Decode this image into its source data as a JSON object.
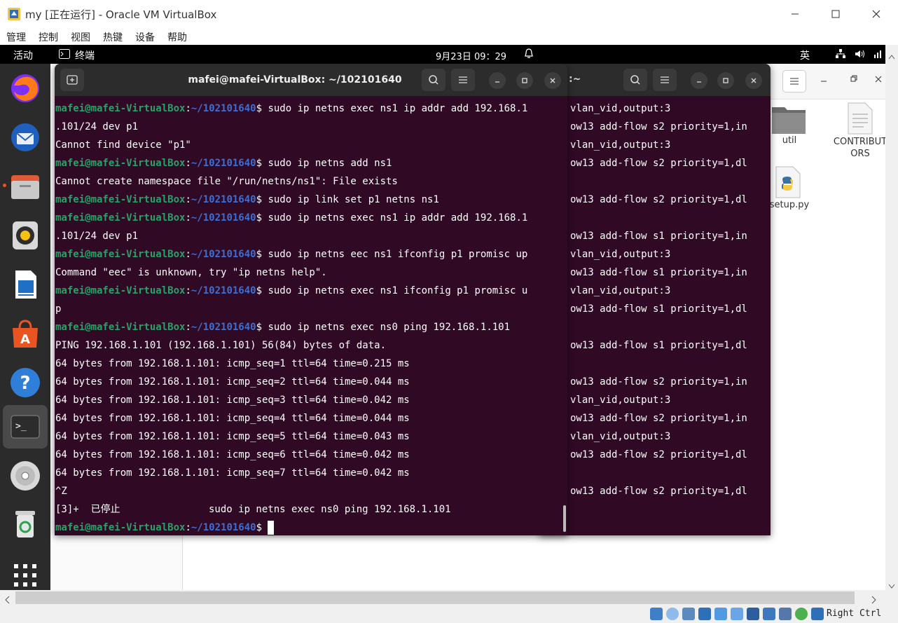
{
  "host": {
    "title": "my [正在运行] - Oracle VM VirtualBox",
    "menu": [
      "管理",
      "控制",
      "视图",
      "热键",
      "设备",
      "帮助"
    ],
    "host_key": "Right Ctrl"
  },
  "topbar": {
    "activities": "活动",
    "app_name": "终端",
    "clock": "9月23日  09：29",
    "ime": "英"
  },
  "files": {
    "items": [
      {
        "label": "util"
      },
      {
        "label": "CONTRIBUT\nORS"
      },
      {
        "label": "setup.py"
      }
    ]
  },
  "terminal": {
    "title": "mafei@mafei-VirtualBox: ~/102101640",
    "prompt_user": "mafei@mafei-VirtualBox",
    "prompt_path": "~/102101640",
    "lines": [
      {
        "type": "prompt",
        "text": "$ sudo ip netns exec ns1 ip addr add 192.168.1"
      },
      {
        "type": "out",
        "text": ".101/24 dev p1"
      },
      {
        "type": "out",
        "text": "Cannot find device \"p1\""
      },
      {
        "type": "prompt",
        "text": "$ sudo ip netns add ns1"
      },
      {
        "type": "out",
        "text": "Cannot create namespace file \"/run/netns/ns1\": File exists"
      },
      {
        "type": "prompt",
        "text": "$ sudo ip link set p1 netns ns1"
      },
      {
        "type": "prompt",
        "text": "$ sudo ip netns exec ns1 ip addr add 192.168.1"
      },
      {
        "type": "out",
        "text": ".101/24 dev p1"
      },
      {
        "type": "prompt",
        "text": "$ sudo ip netns eec ns1 ifconfig p1 promisc up"
      },
      {
        "type": "out",
        "text": "Command \"eec\" is unknown, try \"ip netns help\"."
      },
      {
        "type": "prompt",
        "text": "$ sudo ip netns exec ns1 ifconfig p1 promisc u"
      },
      {
        "type": "out",
        "text": "p"
      },
      {
        "type": "prompt",
        "text": "$ sudo ip netns exec ns0 ping 192.168.1.101"
      },
      {
        "type": "out",
        "text": "PING 192.168.1.101 (192.168.1.101) 56(84) bytes of data."
      },
      {
        "type": "out",
        "text": "64 bytes from 192.168.1.101: icmp_seq=1 ttl=64 time=0.215 ms"
      },
      {
        "type": "out",
        "text": "64 bytes from 192.168.1.101: icmp_seq=2 ttl=64 time=0.044 ms"
      },
      {
        "type": "out",
        "text": "64 bytes from 192.168.1.101: icmp_seq=3 ttl=64 time=0.042 ms"
      },
      {
        "type": "out",
        "text": "64 bytes from 192.168.1.101: icmp_seq=4 ttl=64 time=0.044 ms"
      },
      {
        "type": "out",
        "text": "64 bytes from 192.168.1.101: icmp_seq=5 ttl=64 time=0.043 ms"
      },
      {
        "type": "out",
        "text": "64 bytes from 192.168.1.101: icmp_seq=6 ttl=64 time=0.042 ms"
      },
      {
        "type": "out",
        "text": "64 bytes from 192.168.1.101: icmp_seq=7 ttl=64 time=0.042 ms"
      },
      {
        "type": "out",
        "text": "^Z"
      },
      {
        "type": "out",
        "text": "[3]+  已停止               sudo ip netns exec ns0 ping 192.168.1.101"
      },
      {
        "type": "cursor",
        "text": "$ "
      }
    ]
  },
  "terminal2": {
    "title_fragment": ":~",
    "lines": [
      "vlan_vid,output:3",
      "ow13 add-flow s2 priority=1,in",
      "vlan_vid,output:3",
      "ow13 add-flow s2 priority=1,dl",
      "",
      "ow13 add-flow s2 priority=1,dl",
      "",
      "ow13 add-flow s1 priority=1,in",
      "vlan_vid,output:3",
      "ow13 add-flow s1 priority=1,in",
      "vlan_vid,output:3",
      "ow13 add-flow s1 priority=1,dl",
      "",
      "ow13 add-flow s1 priority=1,dl",
      "",
      "ow13 add-flow s2 priority=1,in",
      "vlan_vid,output:3",
      "ow13 add-flow s2 priority=1,in",
      "vlan_vid,output:3",
      "ow13 add-flow s2 priority=1,dl",
      "",
      "ow13 add-flow s2 priority=1,dl"
    ]
  },
  "colors": {
    "terminal_bg": "#300a24",
    "prompt_user": "#26a269",
    "prompt_path": "#3b6fd6",
    "header": "#2c2c2c",
    "ubuntu_orange": "#e95420"
  },
  "dock_apps": [
    "firefox-icon",
    "thunderbird-icon",
    "files-icon",
    "rhythmbox-icon",
    "writer-icon",
    "software-icon",
    "help-icon",
    "terminal-icon",
    "disc-icon",
    "trash-icon",
    "app-grid-icon"
  ]
}
